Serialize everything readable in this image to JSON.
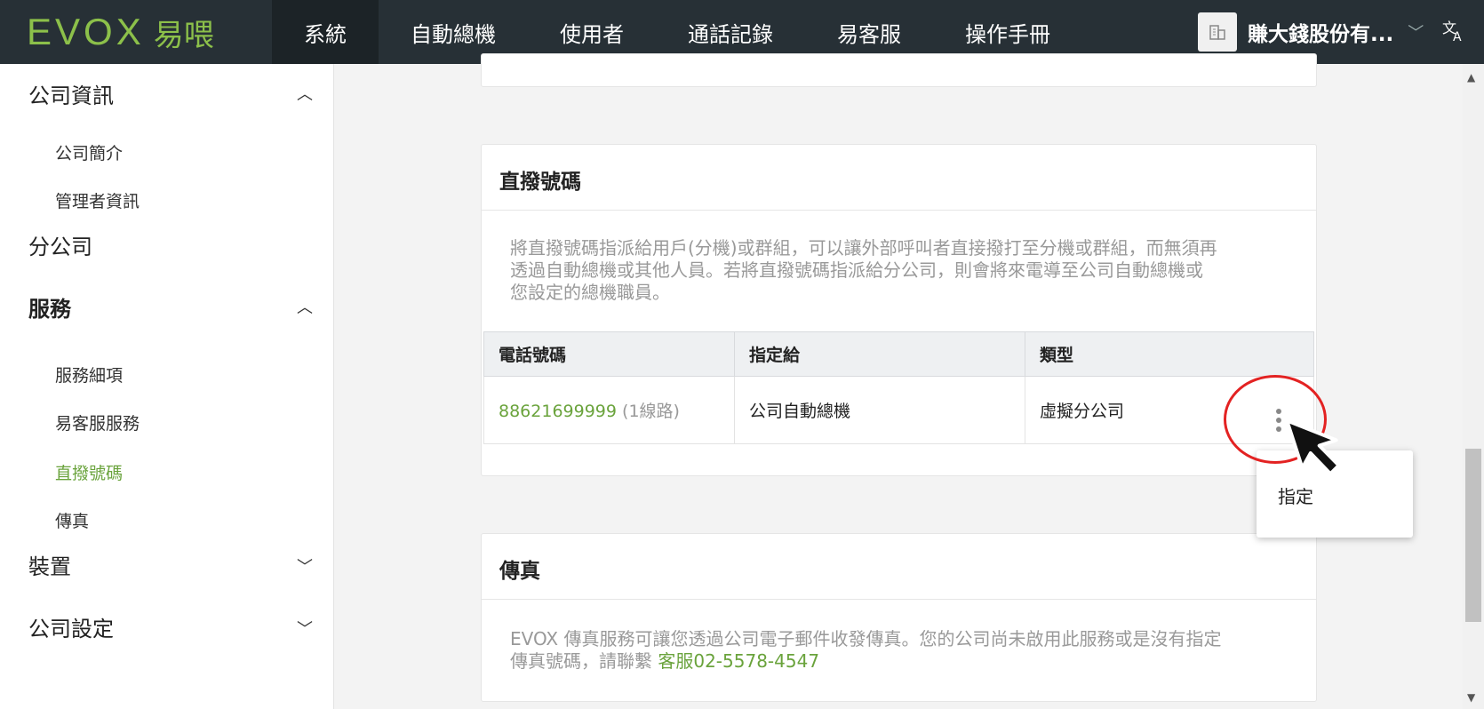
{
  "topbar": {
    "logo_mark": "EVOX",
    "logo_zh": "易喂",
    "nav": [
      "系統",
      "自動總機",
      "使用者",
      "通話記錄",
      "易客服",
      "操作手冊"
    ],
    "company_name": "賺大錢股份有...",
    "company_icon": "building-icon",
    "lang_icon": "translate-icon"
  },
  "sidebar": {
    "company_info": "公司資訊",
    "company_profile": "公司簡介",
    "admin_info": "管理者資訊",
    "branch": "分公司",
    "services": "服務",
    "service_items": "服務細項",
    "helpdesk_service": "易客服服務",
    "direct_numbers": "直撥號碼",
    "fax": "傳真",
    "devices": "裝置",
    "company_settings": "公司設定"
  },
  "direct_card": {
    "title": "直撥號碼",
    "desc_line1": "將直撥號碼指派給用戶(分機)或群組，可以讓外部呼叫者直接撥打至分機或群組，而無須再",
    "desc_line2": "透過自動總機或其他人員。若將直撥號碼指派給分公司，則會將來電導至公司自動總機或",
    "desc_line3": "您設定的總機職員。",
    "columns": [
      "電話號碼",
      "指定給",
      "類型"
    ],
    "row": {
      "phone": "88621699999",
      "lines": "(1線路)",
      "assigned_to": "公司自動總機",
      "type": "虛擬分公司"
    }
  },
  "context_menu": {
    "assign": "指定"
  },
  "fax_card": {
    "title": "傳真",
    "desc_line1": "EVOX 傳真服務可讓您透過公司電子郵件收發傳真。您的公司尚未啟用此服務或是沒有指定",
    "desc_line2_prefix": "傳真號碼，請聯繫 ",
    "support_link": "客服02-5578-4547"
  },
  "colors": {
    "topbar": "#273036",
    "brand_green": "#8cc04a",
    "link_green": "#6aa33c",
    "highlight_red": "#e32222"
  }
}
